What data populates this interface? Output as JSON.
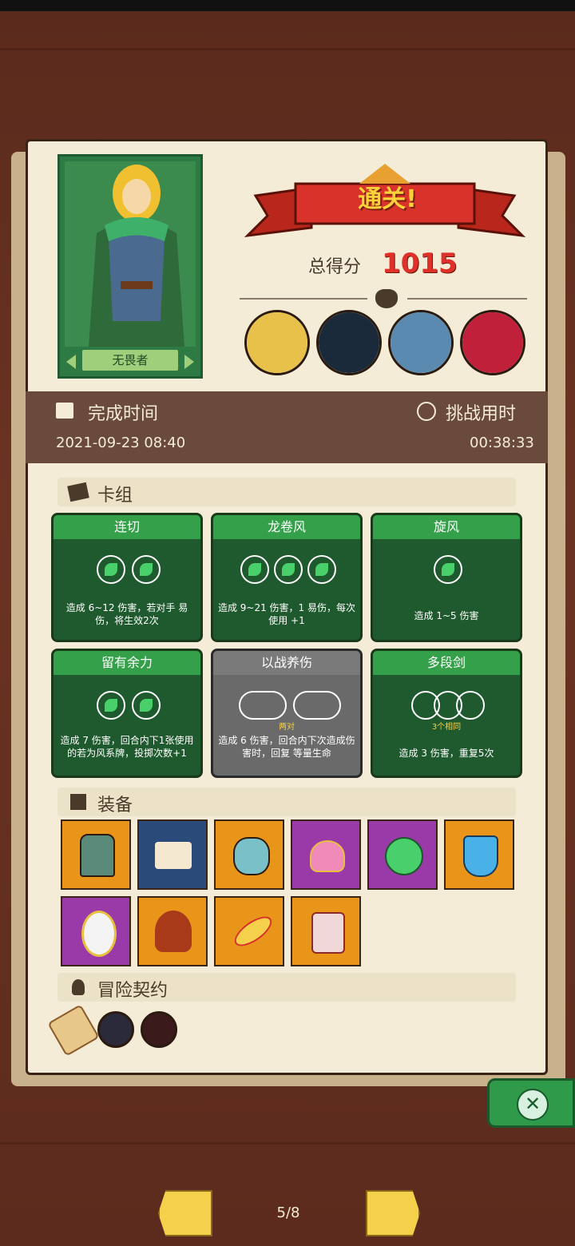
{
  "hero": {
    "name": "无畏者"
  },
  "result": {
    "title": "通关!",
    "score_label": "总得分",
    "score": "1015"
  },
  "bosses": [
    {
      "name": "boss-witch",
      "color": "#e8c14a"
    },
    {
      "name": "boss-shadow",
      "color": "#1a2a3a"
    },
    {
      "name": "boss-rhino",
      "color": "#5a8ab0"
    },
    {
      "name": "boss-vampire",
      "color": "#c0203a"
    }
  ],
  "info": {
    "finish_label": "完成时间",
    "finish_value": "2021-09-23 08:40",
    "duration_label": "挑战用时",
    "duration_value": "00:38:33"
  },
  "deck": {
    "title": "卡组",
    "cards": [
      {
        "name": "连切",
        "orbs": 2,
        "style": "green",
        "desc": "造成 6~12 伤害，若对手 易伤，将生效2次"
      },
      {
        "name": "龙卷风",
        "orbs": 3,
        "style": "green",
        "desc": "造成 9~21 伤害，1 易伤，每次使用 +1"
      },
      {
        "name": "旋风",
        "orbs": 1,
        "style": "green",
        "desc": "造成 1~5 伤害"
      },
      {
        "name": "留有余力",
        "orbs": 2,
        "style": "green",
        "desc": "造成 7 伤害，回合内下1张使用的若为风系牌，投掷次数+1"
      },
      {
        "name": "以战养伤",
        "orbs": 2,
        "style": "gray",
        "sub": "两对",
        "desc": "造成 6 伤害，回合内下次造成伤害时，回复 等量生命"
      },
      {
        "name": "多段剑",
        "orbs": 3,
        "style": "green",
        "sub": "3个相同",
        "desc": "造成 3 伤害，重复5次"
      }
    ]
  },
  "equipment": {
    "title": "装备",
    "items": [
      {
        "name": "helmet",
        "bg": "orange"
      },
      {
        "name": "scroll",
        "bg": "blue"
      },
      {
        "name": "vase",
        "bg": "orange"
      },
      {
        "name": "heart-amulet",
        "bg": "purple"
      },
      {
        "name": "leaf-gem",
        "bg": "purple"
      },
      {
        "name": "crystal-shield",
        "bg": "orange"
      },
      {
        "name": "mirror",
        "bg": "purple"
      },
      {
        "name": "hood",
        "bg": "orange"
      },
      {
        "name": "feather",
        "bg": "orange"
      },
      {
        "name": "jar",
        "bg": "orange"
      }
    ]
  },
  "contract": {
    "title": "冒险契约"
  },
  "pager": {
    "text": "5/8"
  }
}
